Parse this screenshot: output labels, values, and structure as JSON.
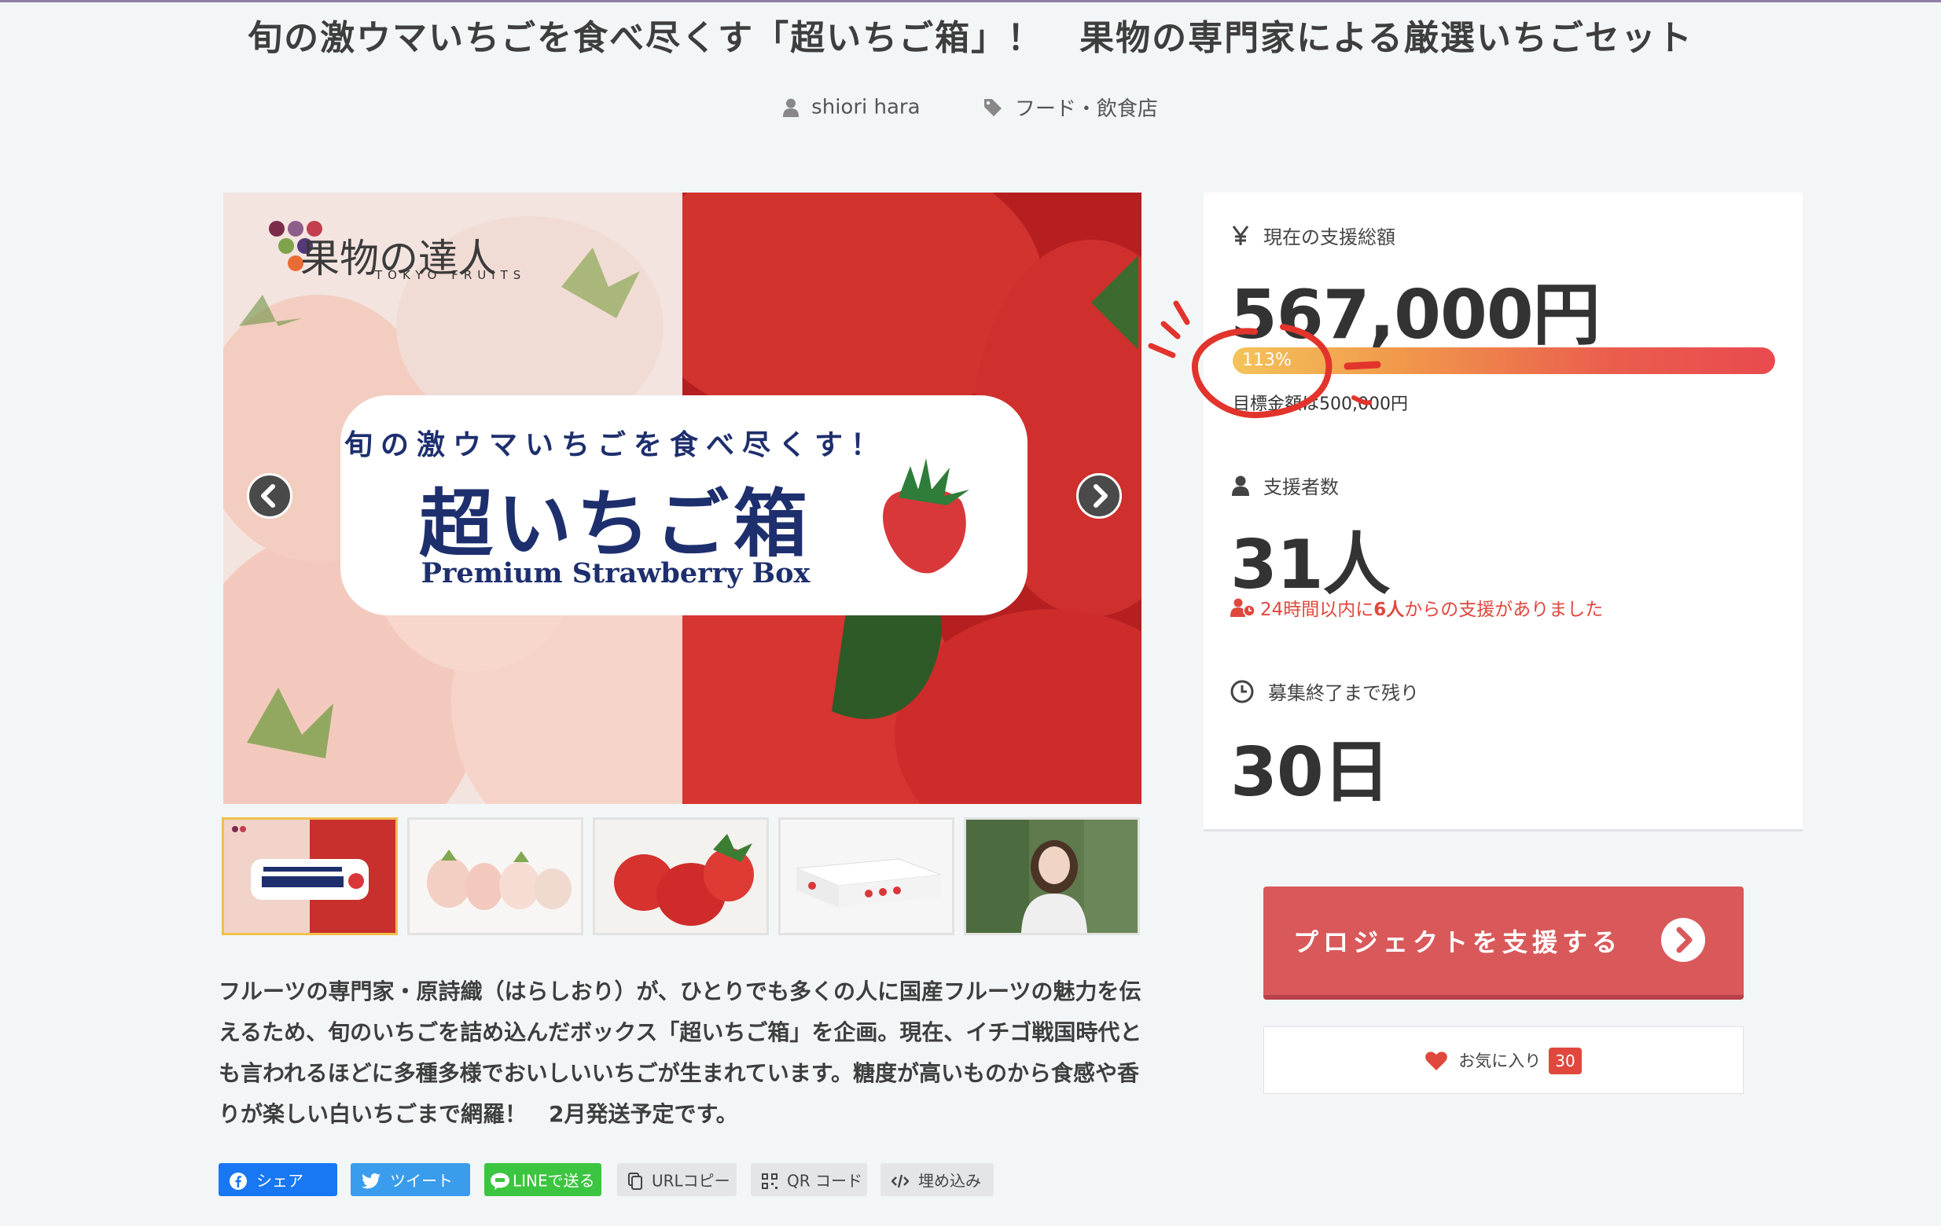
{
  "header": {
    "title": "旬の激ウマいちごを食べ尽くす「超いちご箱」！　果物の専門家による厳選いちごセット",
    "author": "shiori hara",
    "category": "フード・飲食店"
  },
  "hero": {
    "brand_name": "果物の達人",
    "brand_sub": "TOKYO FRUITS",
    "banner_line1": "旬の激ウマいちごを食べ尽くす！",
    "banner_main": "超いちご箱",
    "banner_sub": "Premium Strawberry Box"
  },
  "thumbnails": [
    {
      "name": "thumb-banner",
      "active": true
    },
    {
      "name": "thumb-white-strawberries"
    },
    {
      "name": "thumb-red-strawberries"
    },
    {
      "name": "thumb-gift-box"
    },
    {
      "name": "thumb-portrait"
    }
  ],
  "description": "フルーツの専門家・原詩織（はらしおり）が、ひとりでも多くの人に国産フルーツの魅力を伝えるため、旬のいちごを詰め込んだボックス「超いちご箱」を企画。現在、イチゴ戦国時代とも言われるほどに多種多様でおいしいいちごが生まれています。糖度が高いものから食感や香りが楽しい白いちごまで網羅！　2月発送予定です。",
  "share": {
    "facebook": "シェア",
    "twitter": "ツイート",
    "line": "LINEで送る",
    "url": "URLコピー",
    "qr": "QR コード",
    "embed": "埋め込み"
  },
  "stats": {
    "total_label": "現在の支援総額",
    "total_value": "567,000円",
    "progress_text": "113%",
    "progress_fraction": 1.0,
    "goal_text": "目標金額は500,000円",
    "backers_label": "支援者数",
    "backers_value": "31人",
    "recent_prefix": "24時間以内に",
    "recent_count": "6人",
    "recent_suffix": "からの支援がありました",
    "remaining_label": "募集終了まで残り",
    "remaining_value": "30日"
  },
  "actions": {
    "support_label": "プロジェクトを支援する",
    "favorite_label": "お気に入り",
    "favorite_count": "30"
  },
  "colors": {
    "accent": "#d9595b",
    "alert": "#e0473d",
    "facebook": "#1877f2",
    "twitter": "#3a9cec",
    "line": "#3bc540"
  }
}
